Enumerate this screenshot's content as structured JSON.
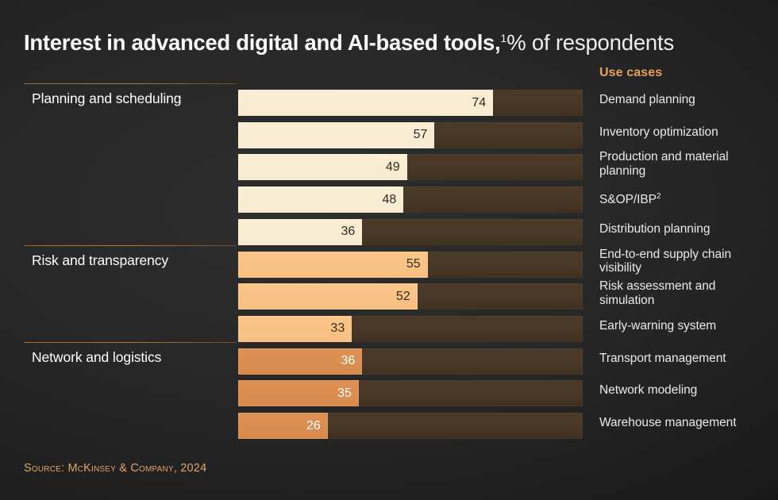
{
  "title": {
    "bold_part": "Interest in advanced digital and AI-based tools,",
    "footnote_marker": "1",
    "regular_part": "% of respondents"
  },
  "columns": {
    "use_cases_header": "Use cases"
  },
  "source": "Source: McKinsey & Company, 2024",
  "colors": {
    "accent": "#e8a05c",
    "group1_fill": "#f9edd4",
    "group2_fill": "#fac68a",
    "group3_fill": "#dd9154",
    "track": "#493827",
    "background": "#262626",
    "rule": "#9a6331"
  },
  "chart_data": {
    "type": "bar",
    "title": "Interest in advanced digital and AI-based tools, % of respondents",
    "xlabel": "",
    "ylabel": "",
    "xlim": [
      0,
      100
    ],
    "grid": false,
    "orientation": "horizontal",
    "value_unit": "%",
    "legend": [
      {
        "name": "Planning and scheduling",
        "color": "#f9edd4"
      },
      {
        "name": "Risk and transparency",
        "color": "#fac68a"
      },
      {
        "name": "Network and logistics",
        "color": "#dd9154"
      }
    ],
    "groups": [
      {
        "label": "Planning and scheduling",
        "color_key": "g1",
        "rows": [
          {
            "use_case": "Demand planning",
            "value": 74,
            "lines": 1
          },
          {
            "use_case": "Inventory optimization",
            "value": 57,
            "lines": 1
          },
          {
            "use_case": "Production and material planning",
            "value": 49,
            "lines": 2
          },
          {
            "use_case": "S&OP/IBP",
            "use_case_sup": "2",
            "value": 48,
            "lines": 1
          },
          {
            "use_case": "Distribution planning",
            "value": 36,
            "lines": 1
          }
        ]
      },
      {
        "label": "Risk and transparency",
        "color_key": "g2",
        "rows": [
          {
            "use_case": "End-to-end supply chain visibility",
            "value": 55,
            "lines": 2
          },
          {
            "use_case": "Risk assessment and simulation",
            "value": 52,
            "lines": 2
          },
          {
            "use_case": "Early-warning system",
            "value": 33,
            "lines": 1
          }
        ]
      },
      {
        "label": "Network and logistics",
        "color_key": "g3",
        "rows": [
          {
            "use_case": "Transport management",
            "value": 36,
            "lines": 1
          },
          {
            "use_case": "Network modeling",
            "value": 35,
            "lines": 1
          },
          {
            "use_case": "Warehouse management",
            "value": 26,
            "lines": 1
          }
        ]
      }
    ],
    "categories": [
      "Demand planning",
      "Inventory optimization",
      "Production and material planning",
      "S&OP/IBP",
      "Distribution planning",
      "End-to-end supply chain visibility",
      "Risk assessment and simulation",
      "Early-warning system",
      "Transport management",
      "Network modeling",
      "Warehouse management"
    ],
    "values": [
      74,
      57,
      49,
      48,
      36,
      55,
      52,
      33,
      36,
      35,
      26
    ]
  }
}
